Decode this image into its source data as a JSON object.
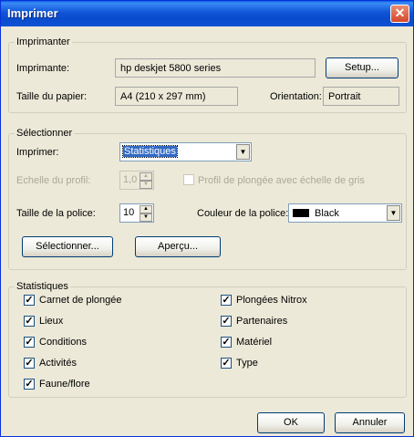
{
  "window": {
    "title": "Imprimer",
    "close": "✕"
  },
  "imprimanter": {
    "legend": "Imprimanter",
    "printer_label": "Imprimante:",
    "printer_value": "hp deskjet 5800 series",
    "setup_button": "Setup...",
    "paper_label": "Taille du papier:",
    "paper_value": "A4 (210 x 297 mm)",
    "orientation_label": "Orientation:",
    "orientation_value": "Portrait"
  },
  "selectionner": {
    "legend": "Sélectionner",
    "imprimer_label": "Imprimer:",
    "imprimer_value": "Statistiques",
    "echelle_label": "Echelle du profil:",
    "echelle_value": "1,0",
    "profil_checkbox_label": "Profil de plongée avec échelle de gris",
    "taille_label": "Taille de la police:",
    "taille_value": "10",
    "couleur_label": "Couleur de la police:",
    "couleur_value": "Black",
    "selectionner_button": "Sélectionner...",
    "apercu_button": "Aperçu..."
  },
  "statistiques": {
    "legend": "Statistiques",
    "left": [
      {
        "label": "Carnet de plongée",
        "checked": true
      },
      {
        "label": "Lieux",
        "checked": true
      },
      {
        "label": "Conditions",
        "checked": true
      },
      {
        "label": "Activités",
        "checked": true
      },
      {
        "label": "Faune/flore",
        "checked": true
      }
    ],
    "right": [
      {
        "label": "Plongées Nitrox",
        "checked": true
      },
      {
        "label": "Partenaires",
        "checked": true
      },
      {
        "label": "Matériel",
        "checked": true
      },
      {
        "label": "Type",
        "checked": true
      }
    ]
  },
  "footer": {
    "ok_button": "OK",
    "cancel_button": "Annuler"
  },
  "icons": {
    "checkmark": "✓",
    "dropdown": "▼",
    "spin_up": "▲",
    "spin_down": "▼"
  }
}
